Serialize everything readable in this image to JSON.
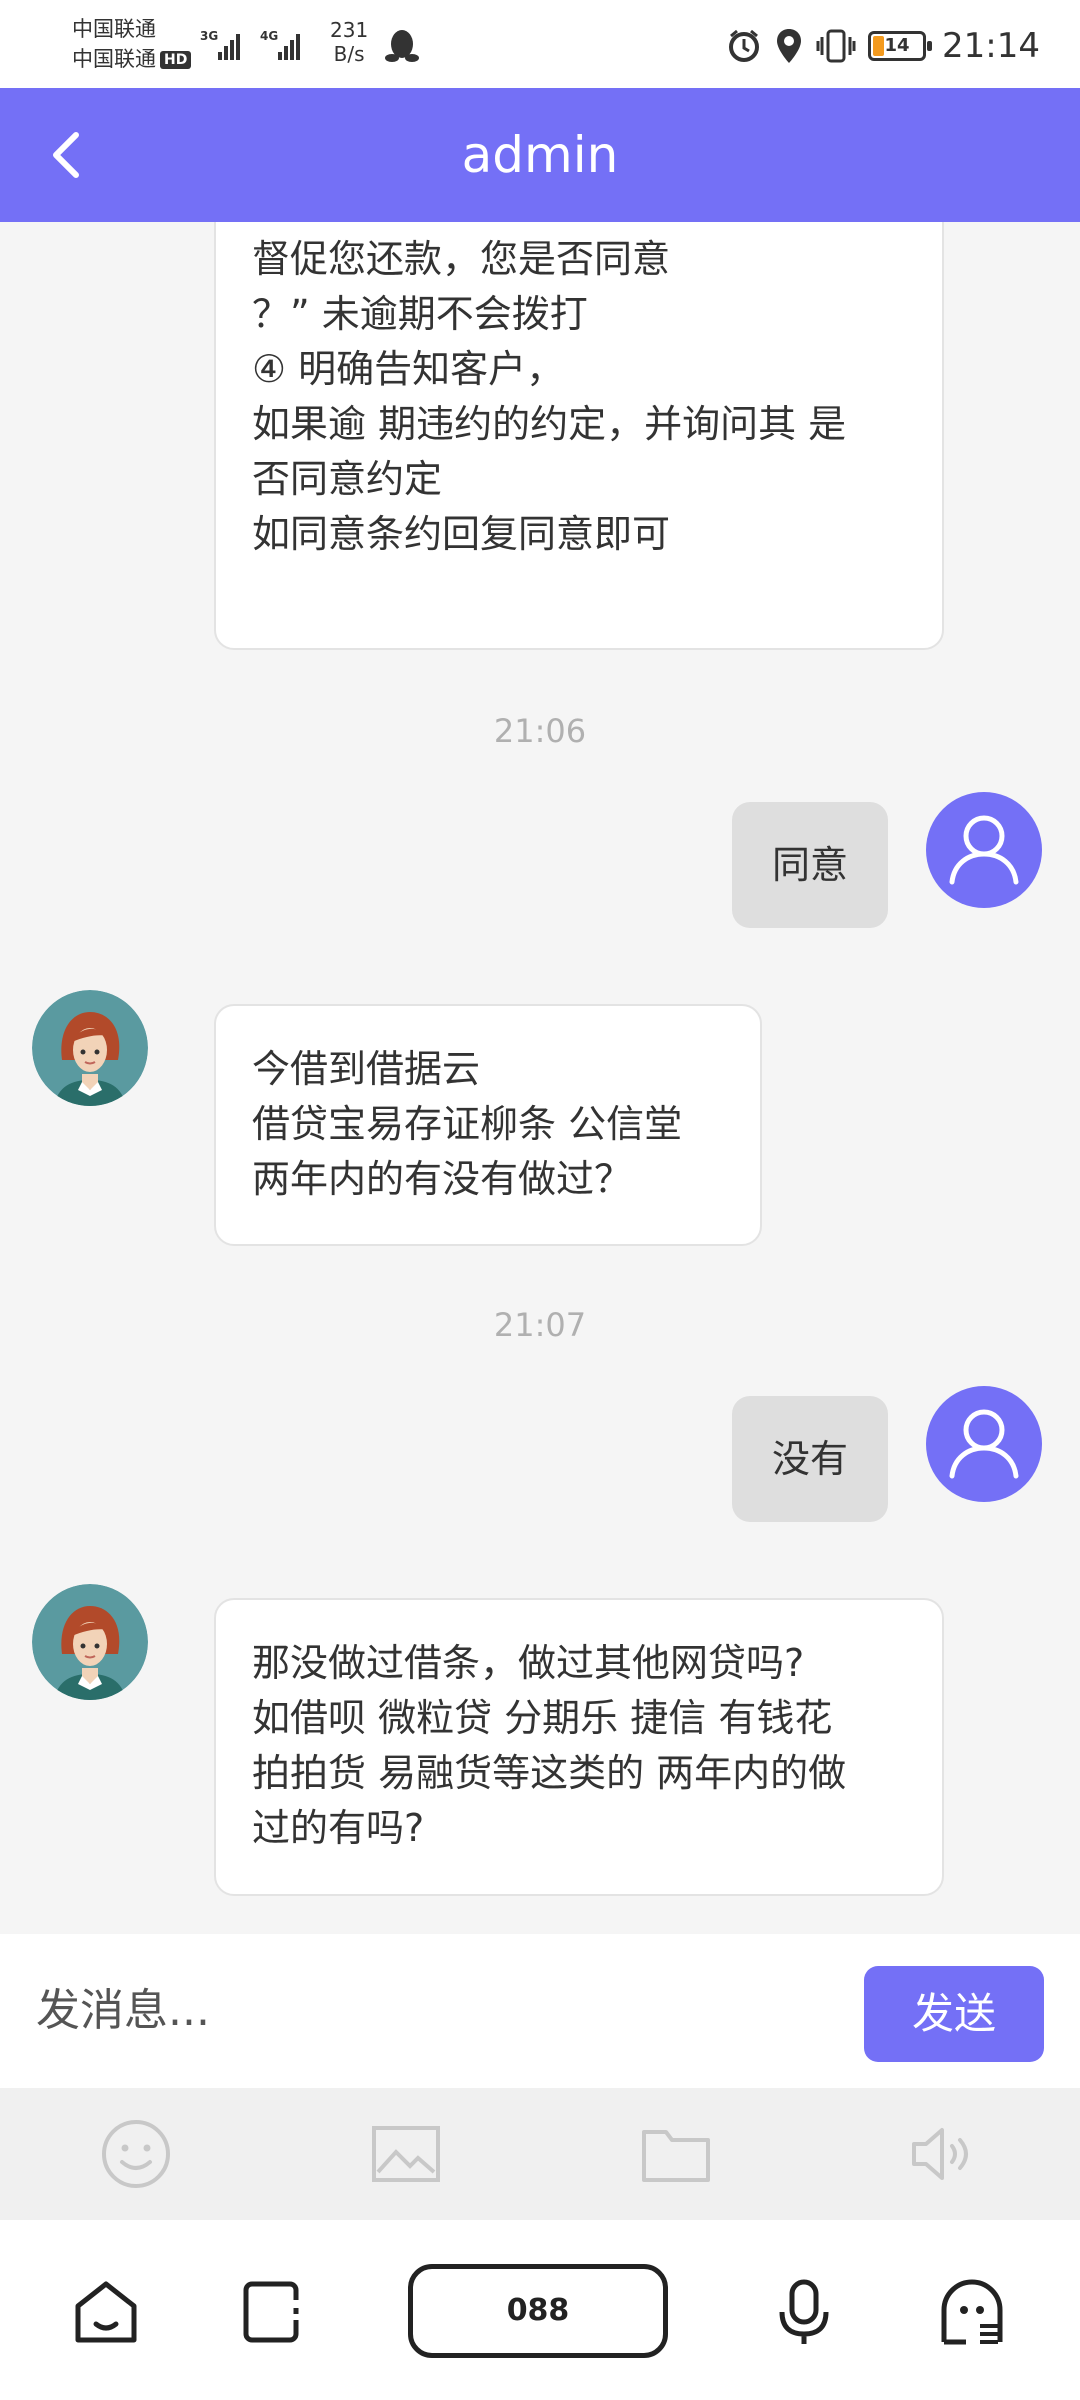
{
  "status_bar": {
    "carrier1": "中国联通",
    "carrier2": "中国联通",
    "hd": "HD",
    "net1": "3G",
    "net2": "4G",
    "speed_value": "231",
    "speed_unit": "B/s",
    "battery": "14",
    "time": "21:14"
  },
  "header": {
    "title": "admin",
    "back_icon": "chevron-left-icon"
  },
  "messages": [
    {
      "side": "left",
      "lines": [
        "督促您还款，您是否同意",
        "？” 未逾期不会拨打",
        "④ 明确告知客户，",
        "如果逾 期违约的约定，并询问其 是",
        "否同意约定",
        "如同意条约回复同意即可"
      ]
    },
    {
      "type": "timestamp",
      "text": "21:06"
    },
    {
      "side": "right",
      "text": "同意"
    },
    {
      "side": "left",
      "lines": [
        "今借到借据云",
        "借贷宝易存证柳条 公信堂",
        "两年内的有没有做过？"
      ]
    },
    {
      "type": "timestamp",
      "text": "21:07"
    },
    {
      "side": "right",
      "text": "没有"
    },
    {
      "side": "left",
      "lines": [
        "那没做过借条，做过其他网贷吗?",
        "如借呗 微粒贷 分期乐 捷信 有钱花",
        "拍拍货 易融货等这类的 两年内的做",
        "过的有吗?"
      ]
    }
  ],
  "input": {
    "placeholder": "发消息...",
    "send_label": "发送"
  },
  "toolbar": {
    "icons": [
      "emoji-icon",
      "image-icon",
      "folder-icon",
      "speaker-icon"
    ]
  },
  "system_nav": {
    "pill_label": "088",
    "icons": [
      "home-icon",
      "recents-icon",
      "mic-icon",
      "assistant-icon"
    ]
  },
  "colors": {
    "accent": "#7470f6",
    "background": "#f5f5f5",
    "bubble_right": "#dedede",
    "bubble_left": "#ffffff"
  }
}
